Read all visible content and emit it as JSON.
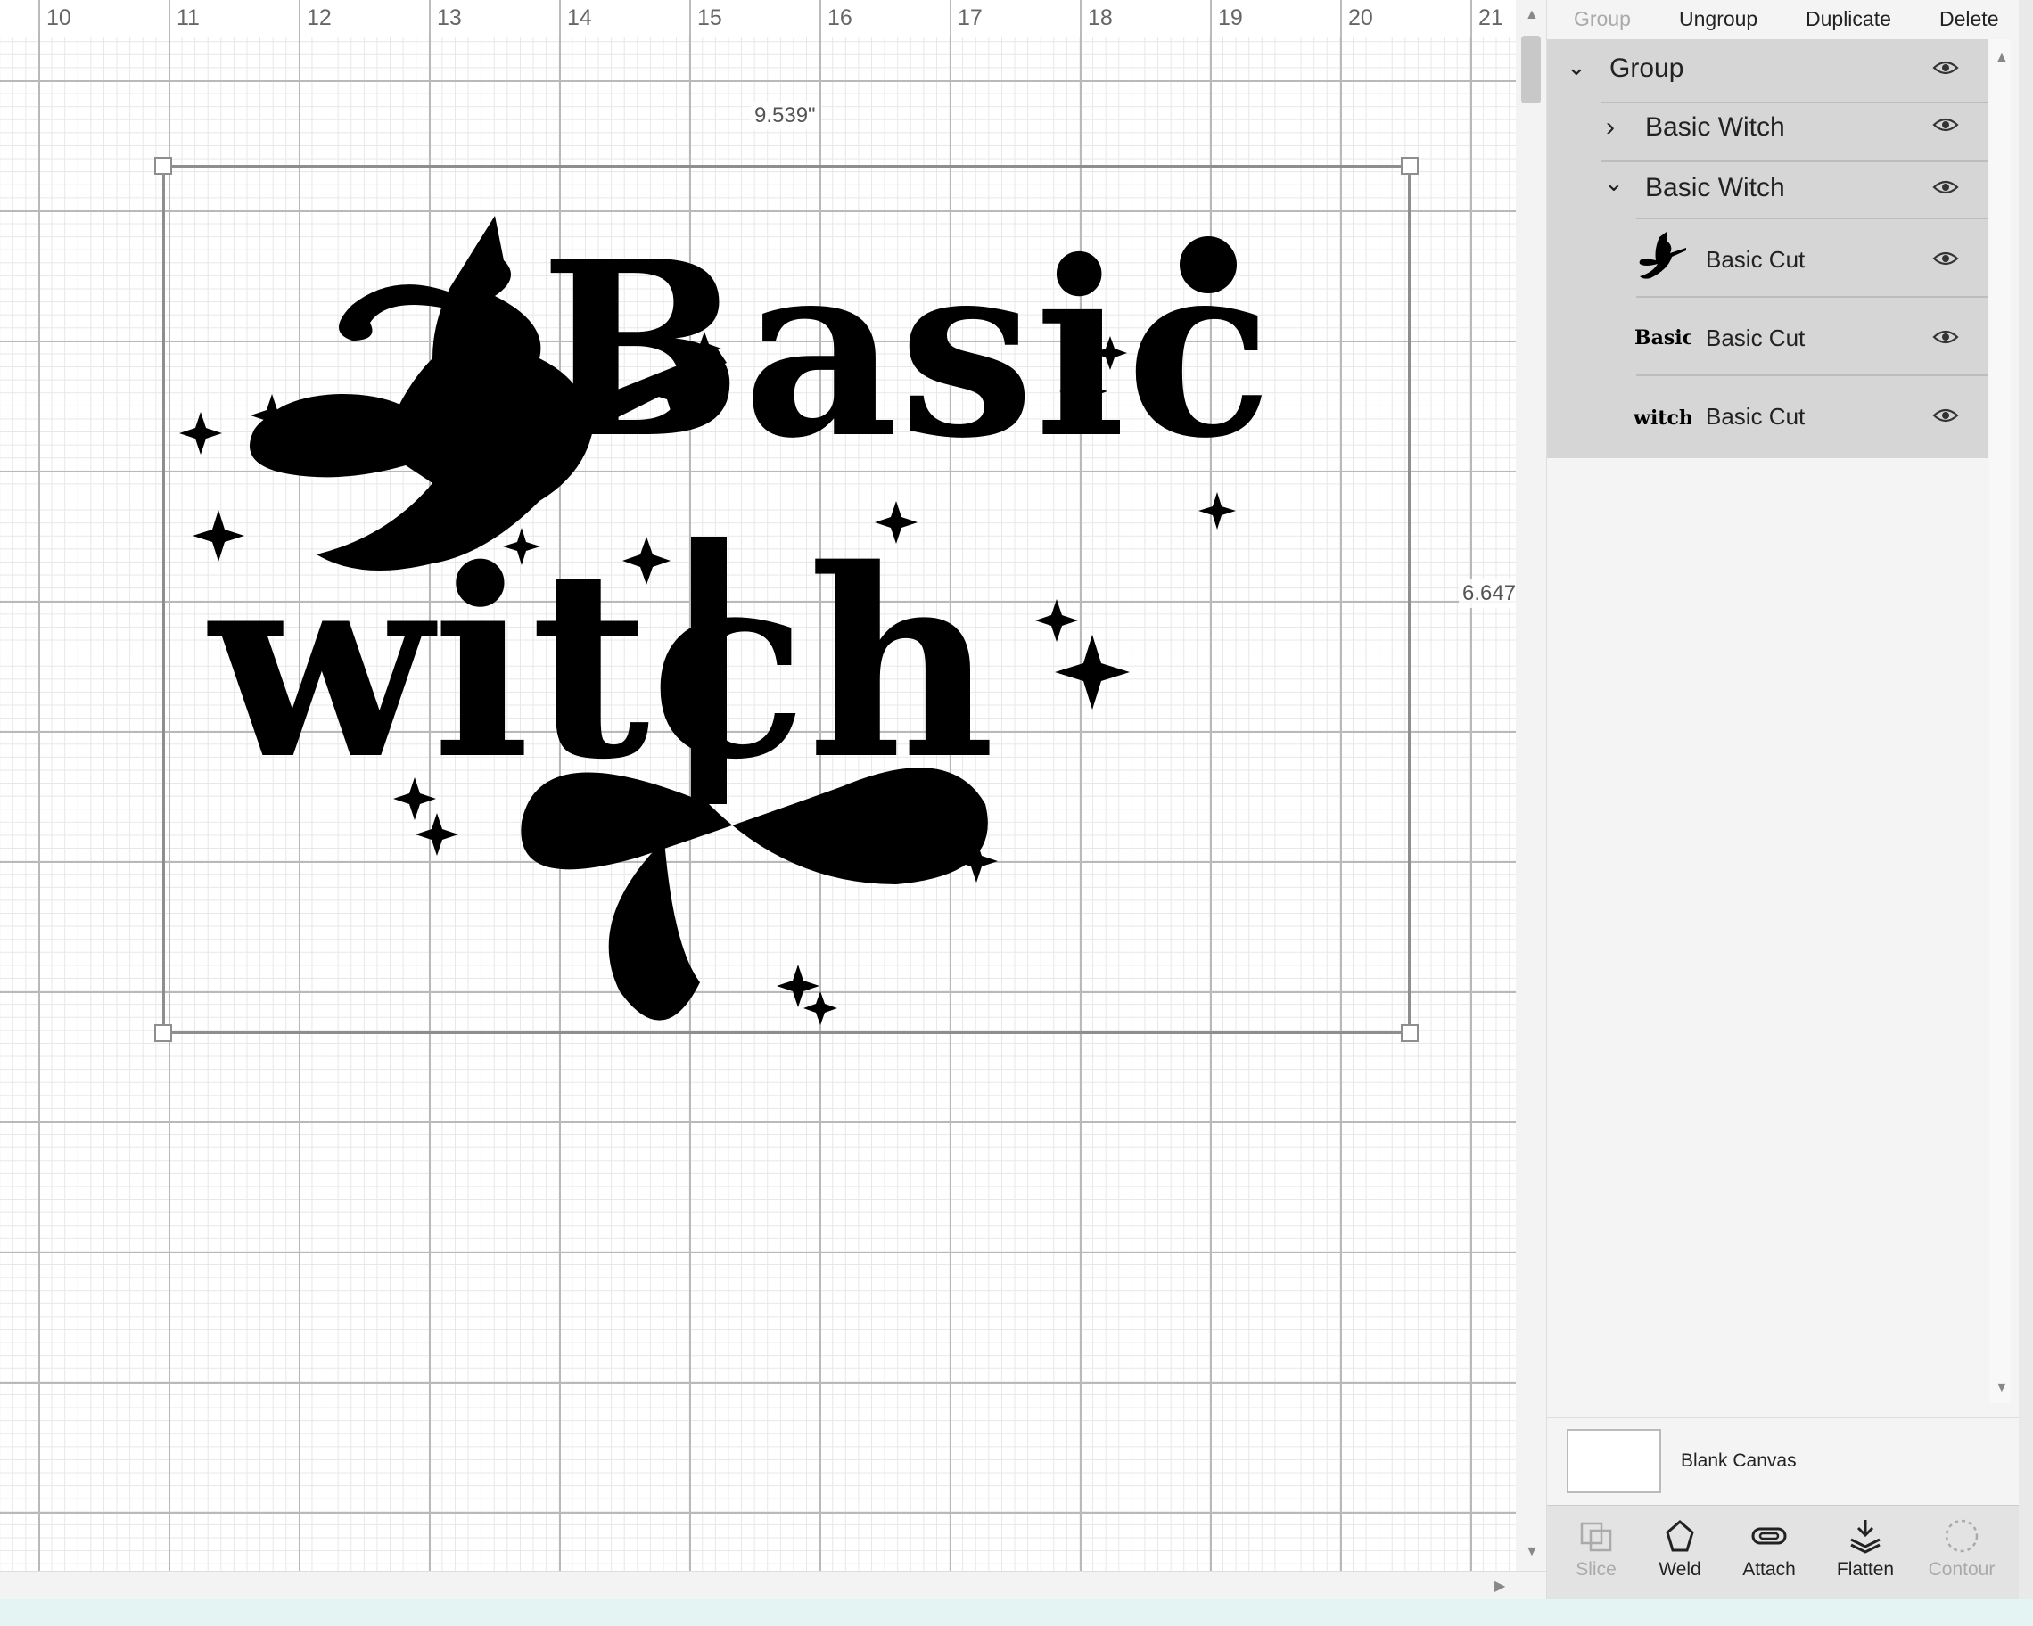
{
  "ruler": {
    "labels": [
      "10",
      "11",
      "12",
      "13",
      "14",
      "15",
      "16",
      "17",
      "18",
      "19",
      "20",
      "21"
    ]
  },
  "dimensions": {
    "width": "9.539\"",
    "height": "6.647"
  },
  "toolbar": {
    "group": "Group",
    "ungroup": "Ungroup",
    "duplicate": "Duplicate",
    "delete": "Delete"
  },
  "layers": {
    "group": "Group",
    "sub1": "Basic Witch",
    "sub2": "Basic Witch",
    "items": [
      "Basic Cut",
      "Basic Cut",
      "Basic Cut"
    ],
    "thumbs": {
      "t2": "Basic",
      "t3": "witch"
    }
  },
  "canvas_card": {
    "label": "Blank Canvas"
  },
  "actions": {
    "slice": "Slice",
    "weld": "Weld",
    "attach": "Attach",
    "flatten": "Flatten",
    "contour": "Contour"
  },
  "artwork": {
    "line1": "Basic",
    "line2": "witch"
  },
  "colors": {
    "accent": "#7b4fd6",
    "ink": "#000000"
  }
}
